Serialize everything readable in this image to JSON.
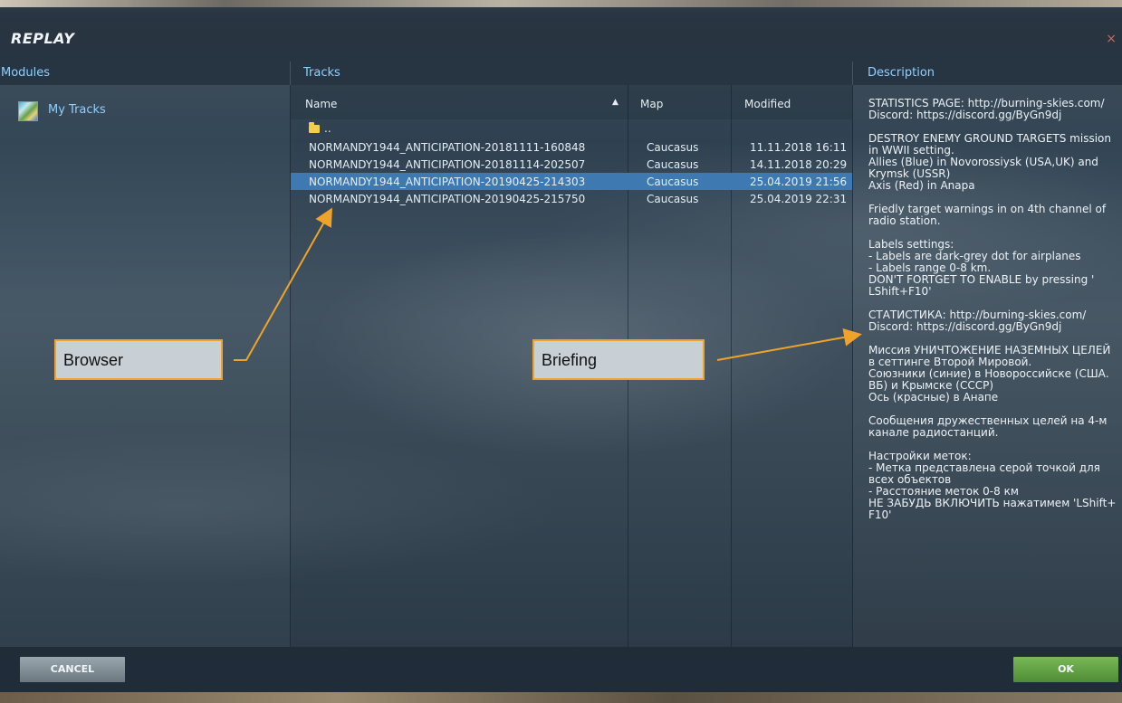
{
  "window": {
    "title": "REPLAY",
    "close_glyph": "×"
  },
  "columns": {
    "modules": "Modules",
    "tracks": "Tracks",
    "description": "Description"
  },
  "modules": [
    {
      "label": "My Tracks",
      "icon": "my-tracks-icon"
    }
  ],
  "tracks_table": {
    "headers": {
      "name": "Name",
      "map": "Map",
      "modified": "Modified"
    },
    "sort": "Name ascending",
    "parent_folder": "..",
    "rows": [
      {
        "name": "NORMANDY1944_ANTICIPATION-20181111-160848",
        "map": "Caucasus",
        "modified": "11.11.2018 16:11",
        "selected": false
      },
      {
        "name": "NORMANDY1944_ANTICIPATION-20181114-202507",
        "map": "Caucasus",
        "modified": "14.11.2018 20:29",
        "selected": false
      },
      {
        "name": "NORMANDY1944_ANTICIPATION-20190425-214303",
        "map": "Caucasus",
        "modified": "25.04.2019 21:56",
        "selected": true
      },
      {
        "name": "NORMANDY1944_ANTICIPATION-20190425-215750",
        "map": "Caucasus",
        "modified": "25.04.2019 22:31",
        "selected": false
      }
    ]
  },
  "description_text": "STATISTICS PAGE: http://burning-skies.com/\nDiscord: https://discord.gg/ByGn9dj\n\nDESTROY ENEMY GROUND TARGETS mission in WWII setting.\nAllies (Blue) in Novorossiysk (USA,UK) and Krymsk (USSR)\nAxis (Red) in Anapa\n\nFriedly target warnings in on 4th channel of radio station.\n\nLabels settings:\n- Labels are dark-grey dot for airplanes\n- Labels range 0-8 km.\nDON'T FORTGET TO ENABLE by pressing ' LShift+F10'\n\nСТАТИСТИКА: http://burning-skies.com/\nDiscord: https://discord.gg/ByGn9dj\n\nМиссия УНИЧТОЖЕНИЕ НАЗЕМНЫХ ЦЕЛЕЙ в сеттинге Второй Мировой.\nСоюзники (синие) в Новороссийске (США. ВБ) и Крымске (СССР)\nОсь (красные) в Анапе\n\nСообщения дружественных целей на 4-м канале радиостанций.\n\nНастройки меток:\n- Метка представлена серой точкой для всех объектов\n- Расстояние меток 0-8 км\nНЕ ЗАБУДЬ ВКЛЮЧИТЬ нажатимем 'LShift+ F10'",
  "footer": {
    "cancel": "CANCEL",
    "ok": "OK"
  },
  "callouts": {
    "browser": "Browser",
    "briefing": "Briefing"
  },
  "colors": {
    "accent_text": "#8fd0ff",
    "selected_row": "#3e79b2",
    "ok_button": "#5c9c40",
    "callout_border": "#f0a32a"
  }
}
